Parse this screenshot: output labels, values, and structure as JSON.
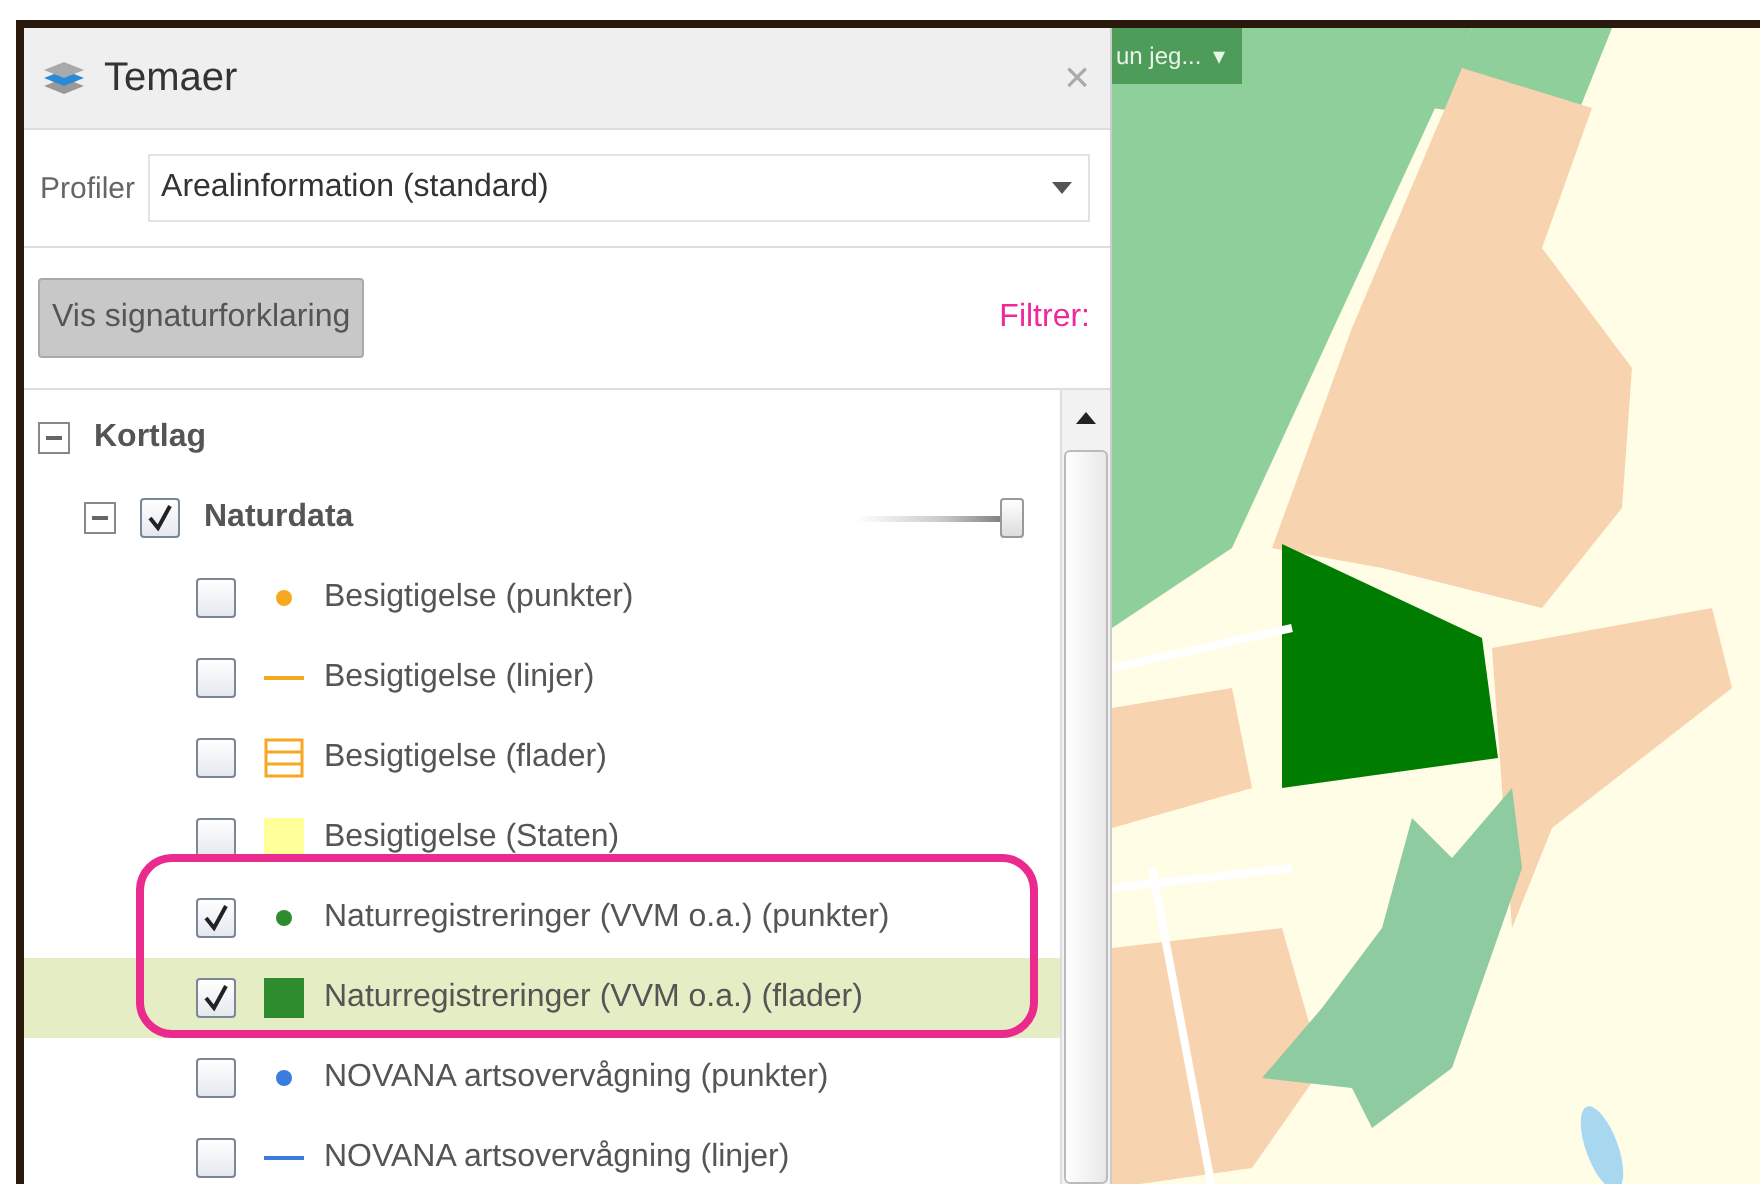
{
  "panel": {
    "title": "Temaer",
    "close": "×",
    "profile_label": "Profiler",
    "profile_value": "Arealinformation (standard)",
    "legend_button": "Vis signaturforklaring",
    "filter_label": "Filtrer:"
  },
  "tree": {
    "label": "Kortlag",
    "expanded": true,
    "children": [
      {
        "label": "Naturdata",
        "expanded": true,
        "checked": true,
        "level": 1,
        "children": [
          {
            "label": "Besigtigelse (punkter)",
            "checked": false,
            "selected": false,
            "kind": "point",
            "color": "#f7a823"
          },
          {
            "label": "Besigtigelse (linjer)",
            "checked": false,
            "selected": false,
            "kind": "line",
            "color": "#f7a823"
          },
          {
            "label": "Besigtigelse (flader)",
            "checked": false,
            "selected": false,
            "kind": "hatch",
            "color": "#f7a823"
          },
          {
            "label": "Besigtigelse (Staten)",
            "checked": false,
            "selected": false,
            "kind": "fill",
            "color": "#ffff99"
          },
          {
            "label": "Naturregistreringer (VVM o.a.) (punkter)",
            "checked": true,
            "selected": false,
            "kind": "point",
            "color": "#2e8b2e"
          },
          {
            "label": "Naturregistreringer (VVM o.a.) (flader)",
            "checked": true,
            "selected": true,
            "kind": "fill",
            "color": "#2e8b2e"
          },
          {
            "label": "NOVANA artsovervågning (punkter)",
            "checked": false,
            "selected": false,
            "kind": "point",
            "color": "#3b7ddd"
          },
          {
            "label": "NOVANA artsovervågning (linjer)",
            "checked": false,
            "selected": false,
            "kind": "line",
            "color": "#3b7ddd"
          }
        ]
      }
    ]
  },
  "map": {
    "kind": "picture",
    "control_label": "un jeg...",
    "control_caret": "▾"
  }
}
